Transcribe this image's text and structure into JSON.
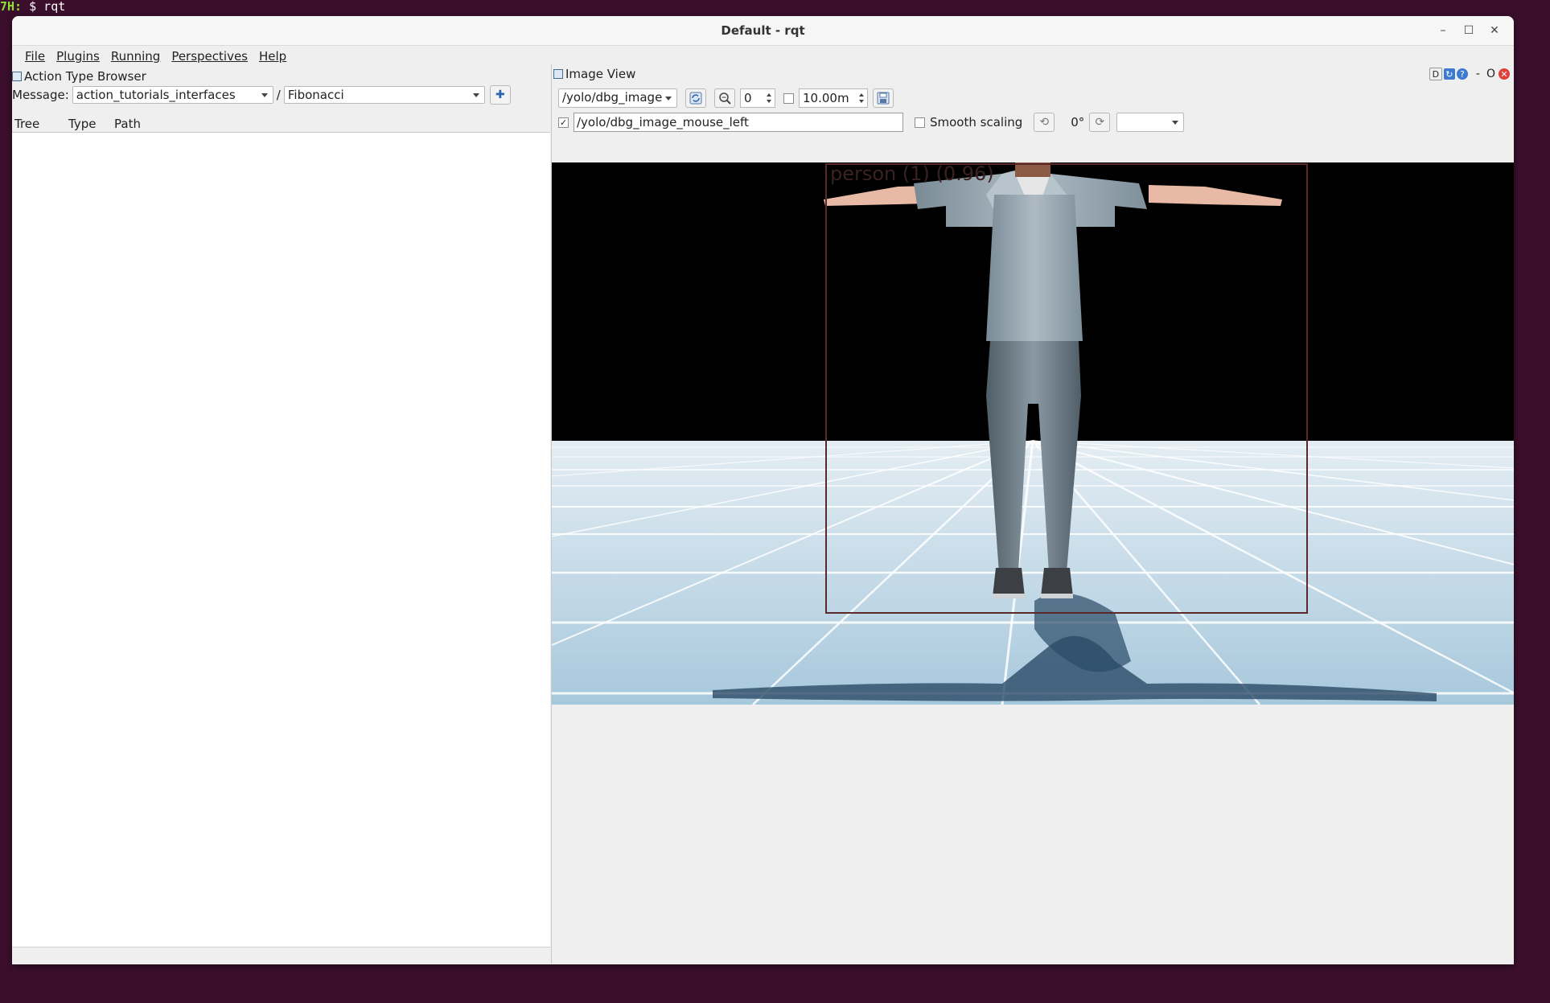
{
  "terminal": {
    "host": "7H:",
    "prompt": "$ rqt"
  },
  "window": {
    "title": "Default - rqt"
  },
  "window_controls": {
    "minimize": "–",
    "maximize": "☐",
    "close": "✕"
  },
  "menubar": [
    {
      "label": "File"
    },
    {
      "label": "Plugins"
    },
    {
      "label": "Running"
    },
    {
      "label": "Perspectives"
    },
    {
      "label": "Help"
    }
  ],
  "action_browser": {
    "title": "Action Type Browser",
    "message_label": "Message:",
    "package": "action_tutorials_interfaces",
    "separator": "/",
    "action": "Fibonacci",
    "add_symbol": "✚",
    "columns": [
      "Tree",
      "Type",
      "Path"
    ]
  },
  "image_view": {
    "title": "Image View",
    "corner": {
      "d": "D",
      "dash": "-",
      "o": "O",
      "close": "✕"
    },
    "topic": "/yolo/dbg_image",
    "refresh_icon": "refresh-icon",
    "zoom_value": "0",
    "timeout_checked": false,
    "timeout_value": "10.00m",
    "mouse_topic_checked": true,
    "mouse_topic": "/yolo/dbg_image_mouse_left",
    "smooth_scaling_label": "Smooth scaling",
    "smooth_scaling_checked": false,
    "rotation": "0°",
    "detection_label": "person (1) (0.96)",
    "colors": {
      "bbox": "#5a2a2a",
      "floor": "#bcd6e6",
      "grid": "#ffffff"
    }
  }
}
